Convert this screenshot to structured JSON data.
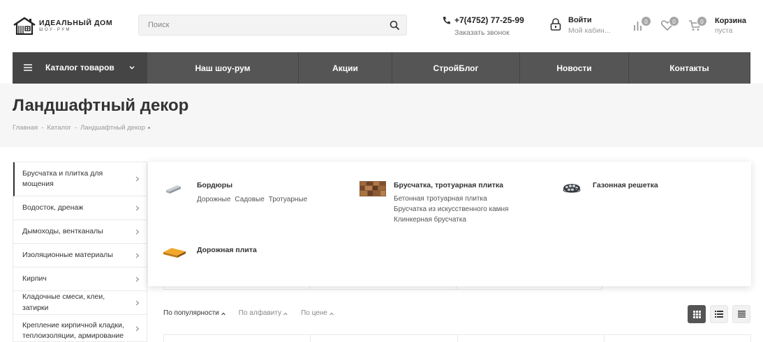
{
  "header": {
    "logo_title": "ИДЕАЛЬНЫЙ ДОМ",
    "logo_sub": "ШОУ-РУМ",
    "search_placeholder": "Поиск",
    "phone": "+7(4752) 77-25-99",
    "callback": "Заказать звонок",
    "login_title": "Войти",
    "login_sub": "Мой кабин...",
    "compare_count": "0",
    "favorites_count": "0",
    "cart_count": "0",
    "cart_title": "Корзина",
    "cart_sub": "пуста"
  },
  "nav": {
    "catalog_label": "Каталог товаров",
    "items": [
      {
        "label": "Наш шоу-рум"
      },
      {
        "label": "Акции"
      },
      {
        "label": "СтройБлог"
      },
      {
        "label": "Новости"
      },
      {
        "label": "Контакты"
      }
    ]
  },
  "page": {
    "title": "Ландшафтный декор",
    "breadcrumb": [
      "Главная",
      "Каталог",
      "Ландшафтный декор"
    ]
  },
  "sidebar": {
    "items": [
      {
        "label": "Брусчатка и плитка для мощения"
      },
      {
        "label": "Водосток, дренаж"
      },
      {
        "label": "Дымоходы, вентканалы"
      },
      {
        "label": "Изоляционные материалы"
      },
      {
        "label": "Кирпич"
      },
      {
        "label": "Кладочные смеси, клеи, затирки"
      },
      {
        "label": "Крепление кирпичной кладки, теплоизоляции, армирование"
      }
    ]
  },
  "submenu": {
    "categories": [
      {
        "name": "Бордюры",
        "subs": [
          "Дорожные",
          "Садовые",
          "Тротуарные"
        ]
      },
      {
        "name": "Брусчатка, тротуарная плитка",
        "subs": [
          "Бетонная тротуарная плитка",
          "Брусчатка из искусственного камня",
          "Клинкерная брусчатка"
        ]
      },
      {
        "name": "Газонная решетка",
        "subs": []
      },
      {
        "name": "Дорожная плита",
        "subs": []
      }
    ]
  },
  "sort": {
    "options": [
      "По популярности",
      "По алфавиту",
      "По цене"
    ]
  },
  "colors": {
    "nav_bg": "#555555",
    "catalog_bg": "#454545",
    "title_bg": "#f6f6f6",
    "badge": "#a6a6a6"
  }
}
